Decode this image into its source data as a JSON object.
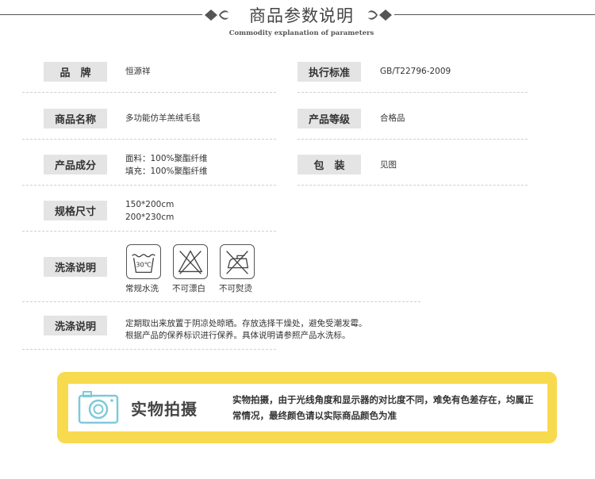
{
  "header": {
    "title": "商品参数说明",
    "subtitle": "Commodity explanation of parameters"
  },
  "params": {
    "brand": {
      "label": "品　牌",
      "value": "恒源祥"
    },
    "standard": {
      "label": "执行标准",
      "value": "GB/T22796-2009"
    },
    "name": {
      "label": "商品名称",
      "value": "多功能仿羊羔绒毛毯"
    },
    "grade": {
      "label": "产品等级",
      "value": "合格品"
    },
    "composition": {
      "label": "产品成分",
      "lines": [
        "面料：100%聚酯纤维",
        "填充：100%聚酯纤维"
      ]
    },
    "package": {
      "label": "包　装",
      "value": "见图"
    },
    "size": {
      "label": "规格尺寸",
      "lines": [
        "150*200cm",
        "200*230cm"
      ]
    }
  },
  "care": {
    "label": "洗涤说明",
    "icons": [
      {
        "icon": "wash-30-icon",
        "text": "30℃",
        "label": "常规水洗"
      },
      {
        "icon": "no-bleach-icon",
        "label": "不可漂白"
      },
      {
        "icon": "no-iron-icon",
        "label": "不可熨烫"
      }
    ]
  },
  "wash_note": {
    "label": "洗涤说明",
    "lines": [
      "定期取出来放置于阴凉处晾晒。存放选择干燥处，避免受潮发霉。",
      "根据产品的保养标识进行保养。具体说明请参照产品水洗标。"
    ]
  },
  "notice": {
    "icon": "camera-icon",
    "title": "实物拍摄",
    "text": "实物拍摄，由于光线角度和显示器的对比度不同，难免有色差存在，均属正常情况，最终颜色请以实际商品颜色为准",
    "colors": {
      "frame": "#f8da4e",
      "camera": "#7fc9d9"
    }
  }
}
